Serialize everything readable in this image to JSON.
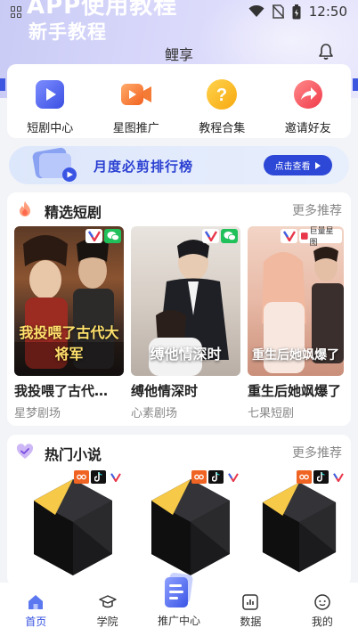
{
  "status_bar": {
    "time": "12:50"
  },
  "hero": {
    "title": "APP使用教程",
    "subtitle": "新手教程"
  },
  "header": {
    "title": "鲤享"
  },
  "quick_actions": [
    {
      "label": "短剧中心",
      "icon": "video-play-icon"
    },
    {
      "label": "星图推广",
      "icon": "video-camera-icon"
    },
    {
      "label": "教程合集",
      "icon": "question-icon"
    },
    {
      "label": "邀请好友",
      "icon": "share-arrow-icon"
    }
  ],
  "banner": {
    "text": "月度必剪排行榜",
    "button": "点击查看"
  },
  "featured": {
    "title": "精选短剧",
    "more": "更多推荐",
    "items": [
      {
        "name": "我投喂了古代…",
        "studio": "星梦剧场",
        "poster_text": "我投喂了古代大将军",
        "platform_label": ""
      },
      {
        "name": "缚他情深时",
        "studio": "心素剧场",
        "poster_text": "缚他情深时",
        "platform_label": ""
      },
      {
        "name": "重生后她飒爆了",
        "studio": "七果短剧",
        "poster_text": "重生后她飒爆了",
        "platform_label": "巨量星图"
      }
    ]
  },
  "novels": {
    "title": "热门小说",
    "more": "更多推荐",
    "count": 3
  },
  "tabbar": [
    {
      "label": "首页",
      "icon": "home-icon",
      "active": true
    },
    {
      "label": "学院",
      "icon": "academy-icon",
      "active": false
    },
    {
      "label": "推广中心",
      "icon": "promotion-center-icon",
      "active": false
    },
    {
      "label": "数据",
      "icon": "data-chart-icon",
      "active": false
    },
    {
      "label": "我的",
      "icon": "profile-icon",
      "active": false
    }
  ],
  "colors": {
    "accent": "#3552e0",
    "wechat": "#20c05a",
    "brand_orange": "#f06423"
  }
}
